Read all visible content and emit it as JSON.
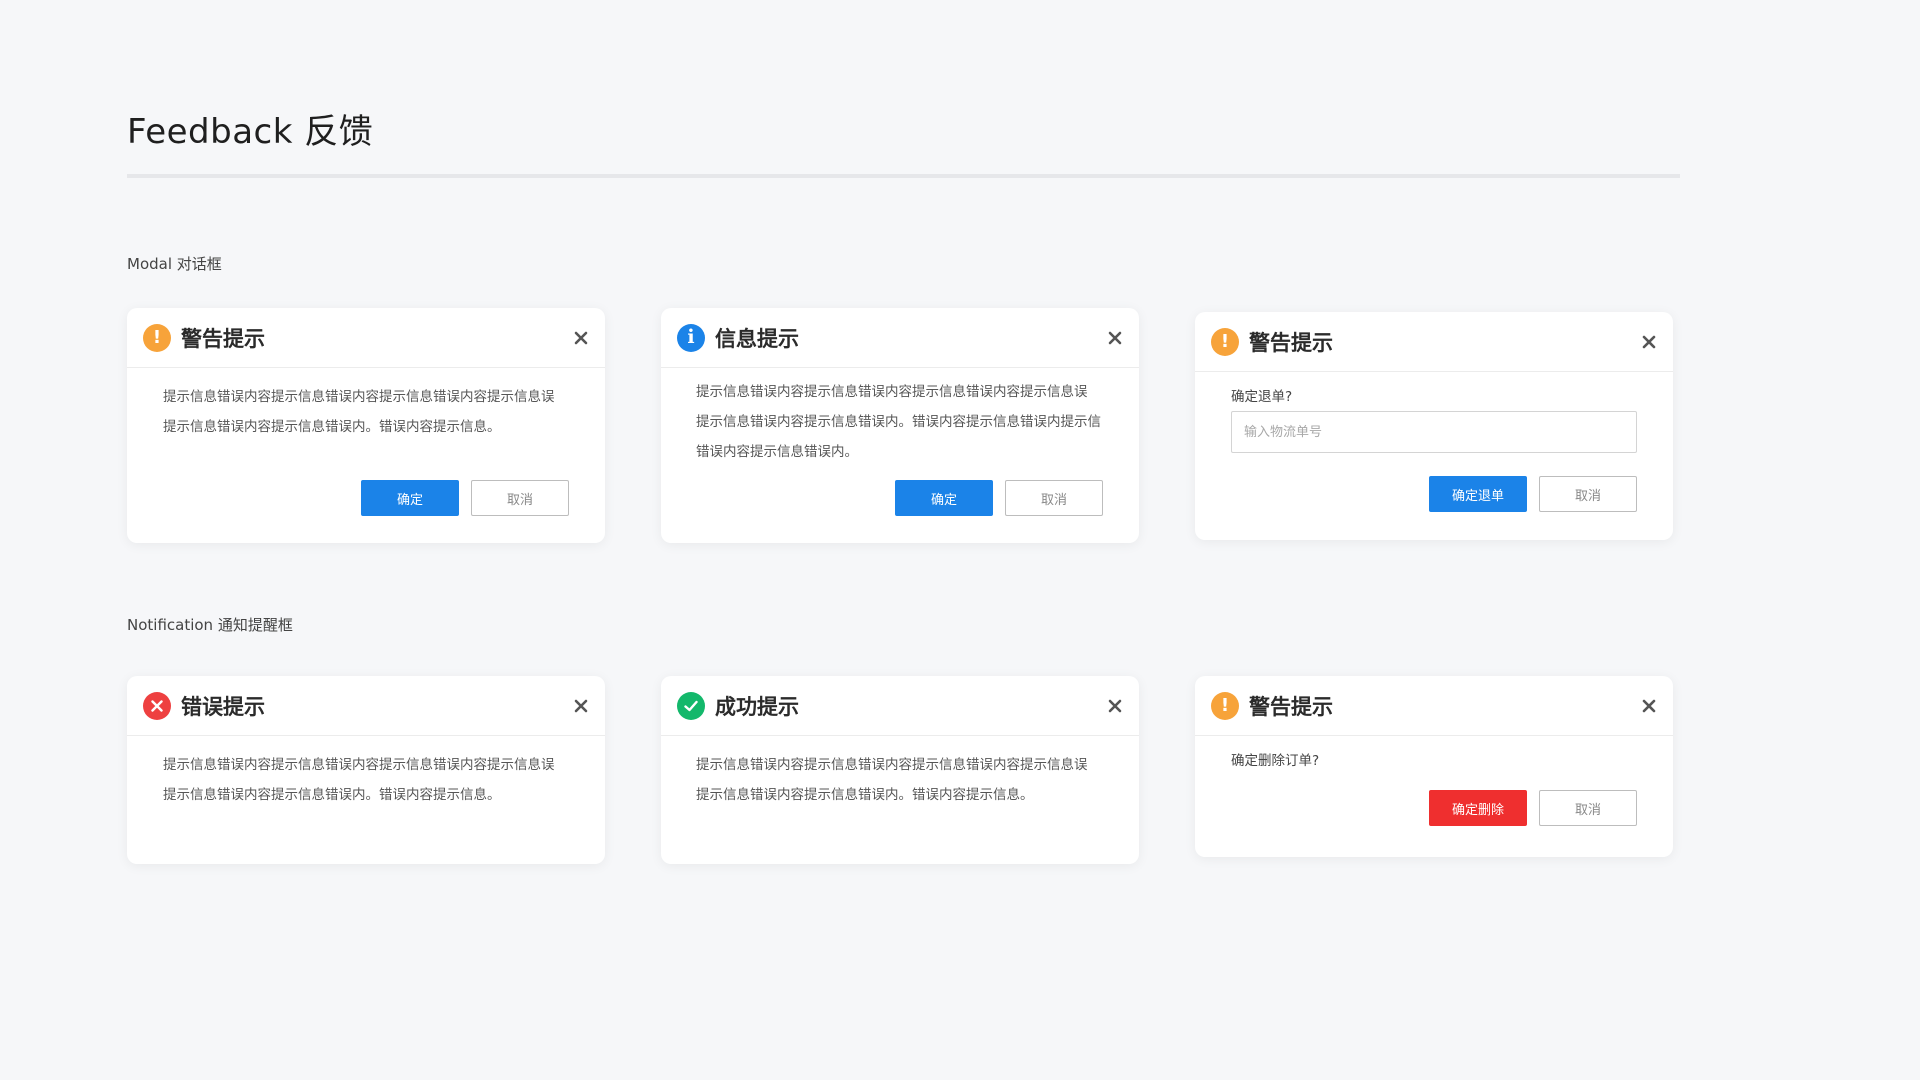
{
  "page": {
    "title": "Feedback 反馈",
    "sections": {
      "modal": "Modal 对话框",
      "notification": "Notification 通知提醒框"
    }
  },
  "colors": {
    "primary": "#1b83e8",
    "warning": "#f7a33a",
    "error": "#ee4040",
    "success": "#13b86b",
    "danger_button": "#ef2f2f"
  },
  "modals": {
    "warning": {
      "icon": "warning-icon",
      "title": "警告提示",
      "body_line1": "提示信息错误内容提示信息错误内容提示信息错误内容提示信息误",
      "body_line2": "提示信息错误内容提示信息错误内。错误内容提示信息。",
      "confirm_label": "确定",
      "cancel_label": "取消"
    },
    "info": {
      "icon": "info-icon",
      "title": "信息提示",
      "body_line1": "提示信息错误内容提示信息错误内容提示信息错误内容提示信息误",
      "body_line2": "提示信息错误内容提示信息错误内。错误内容提示信息错误内提示信",
      "body_line3": "错误内容提示信息错误内。",
      "confirm_label": "确定",
      "cancel_label": "取消"
    },
    "refund": {
      "icon": "warning-icon",
      "title": "警告提示",
      "question": "确定退单?",
      "input_placeholder": "输入物流单号",
      "input_value": "",
      "confirm_label": "确定退单",
      "cancel_label": "取消"
    }
  },
  "notifications": {
    "error": {
      "icon": "error-icon",
      "title": "错误提示",
      "body_line1": "提示信息错误内容提示信息错误内容提示信息错误内容提示信息误",
      "body_line2": "提示信息错误内容提示信息错误内。错误内容提示信息。"
    },
    "success": {
      "icon": "success-icon",
      "title": "成功提示",
      "body_line1": "提示信息错误内容提示信息错误内容提示信息错误内容提示信息误",
      "body_line2": "提示信息错误内容提示信息错误内。错误内容提示信息。"
    },
    "delete": {
      "icon": "warning-icon",
      "title": "警告提示",
      "question": "确定删除订单?",
      "confirm_label": "确定删除",
      "cancel_label": "取消"
    }
  }
}
